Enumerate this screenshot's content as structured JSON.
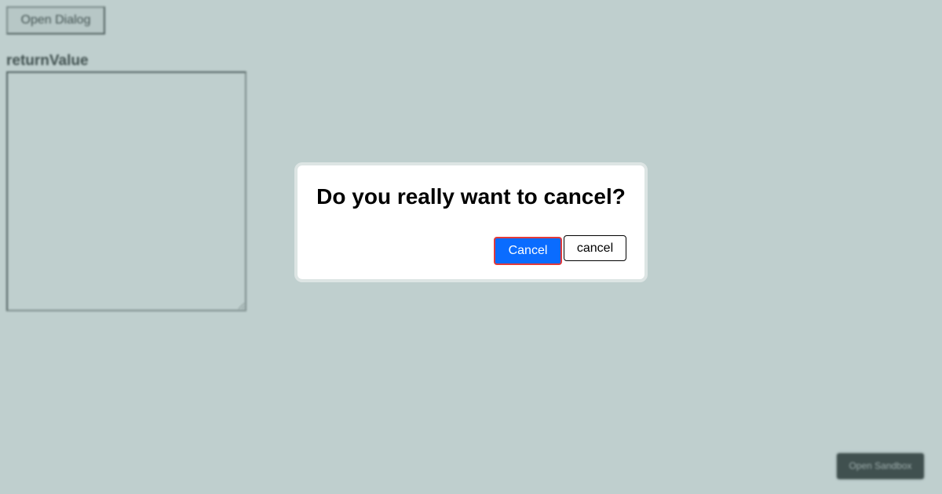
{
  "page": {
    "open_dialog_label": "Open Dialog",
    "return_value_label": "returnValue",
    "return_value_text": "",
    "sandbox_label": "Open Sandbox"
  },
  "dialog": {
    "title": "Do you really want to cancel?",
    "primary_label": "Cancel",
    "secondary_label": "cancel"
  },
  "colors": {
    "backdrop": "#c0cdcc",
    "primary_button": "#0a6cff",
    "primary_focus_ring": "#e23a3a"
  }
}
